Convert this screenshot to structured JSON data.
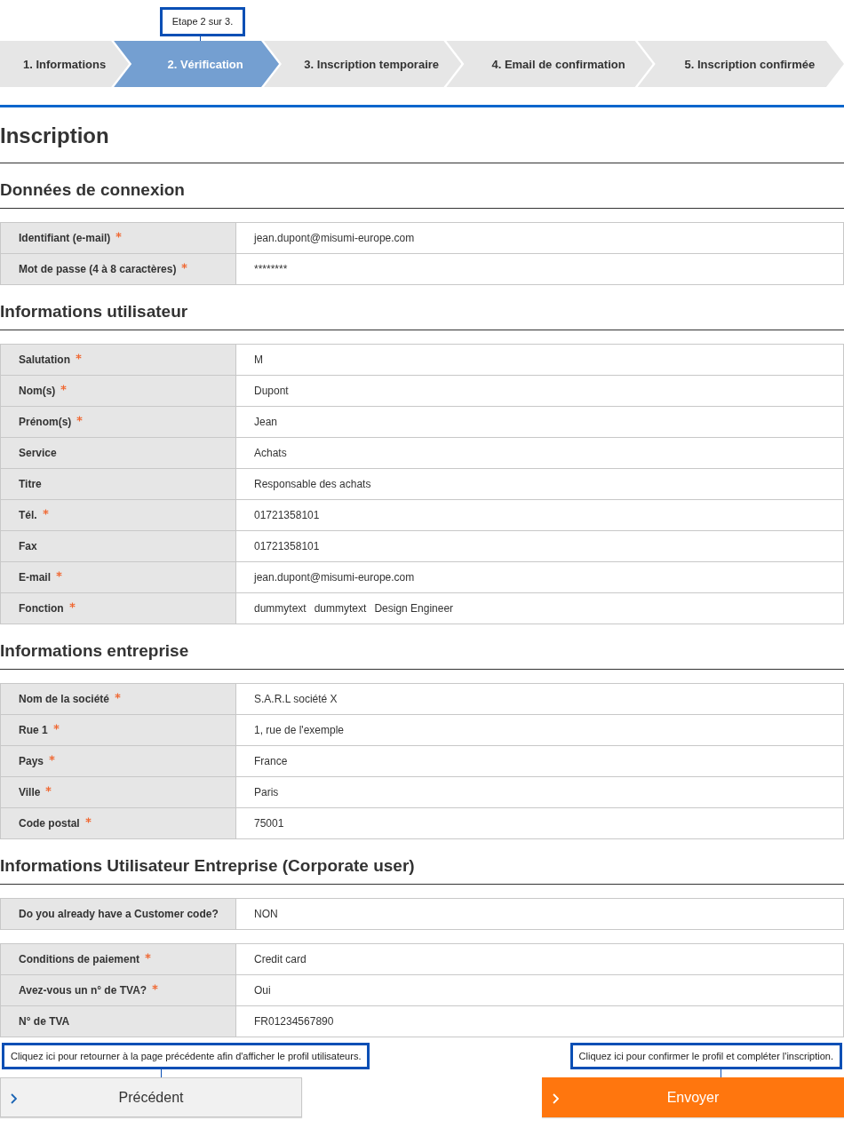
{
  "steps_tooltip": "Etape 2 sur 3.",
  "steps": [
    {
      "label": "1. Informations",
      "selected": false
    },
    {
      "label": "2. Vérification",
      "selected": true
    },
    {
      "label": "3. Inscription temporaire",
      "selected": false
    },
    {
      "label": "4. Email de confirmation",
      "selected": false
    },
    {
      "label": "5. Inscription confirmée",
      "selected": false
    }
  ],
  "title": "Inscription",
  "sections": [
    {
      "heading": "Données de connexion",
      "tables": [
        [
          {
            "label": "Identifiant (e-mail)",
            "required": true,
            "value": "jean.dupont@misumi-europe.com"
          },
          {
            "label": "Mot de passe (4 à 8 caractères)",
            "required": true,
            "value": "********"
          }
        ]
      ]
    },
    {
      "heading": "Informations utilisateur",
      "tables": [
        [
          {
            "label": "Salutation",
            "required": true,
            "value": "M"
          },
          {
            "label": "Nom(s)",
            "required": true,
            "value": "Dupont"
          },
          {
            "label": "Prénom(s)",
            "required": true,
            "value": "Jean"
          },
          {
            "label": "Service",
            "required": false,
            "value": "Achats"
          },
          {
            "label": "Titre",
            "required": false,
            "value": "Responsable des achats"
          },
          {
            "label": "Tél.",
            "required": true,
            "value": "01721358101"
          },
          {
            "label": "Fax",
            "required": false,
            "value": "01721358101"
          },
          {
            "label": "E-mail",
            "required": true,
            "value": "jean.dupont@misumi-europe.com"
          },
          {
            "label": "Fonction",
            "required": true,
            "values": [
              "dummytext",
              "dummytext",
              "Design Engineer"
            ]
          }
        ]
      ]
    },
    {
      "heading": "Informations entreprise",
      "tables": [
        [
          {
            "label": "Nom de la société",
            "required": true,
            "value": "S.A.R.L société X"
          },
          {
            "label": "Rue 1",
            "required": true,
            "value": "1, rue de l'exemple"
          },
          {
            "label": "Pays",
            "required": true,
            "value": "France"
          },
          {
            "label": "Ville",
            "required": true,
            "value": "Paris"
          },
          {
            "label": "Code postal",
            "required": true,
            "value": "75001"
          }
        ]
      ]
    },
    {
      "heading": "Informations Utilisateur Entreprise (Corporate user)",
      "tables": [
        [
          {
            "label": "Do you already have a Customer code?",
            "required": false,
            "value": "NON"
          }
        ],
        [
          {
            "label": "Conditions de paiement",
            "required": true,
            "value": "Credit card"
          },
          {
            "label": "Avez-vous un n° de TVA?",
            "required": true,
            "value": "Oui"
          },
          {
            "label": "N° de TVA",
            "required": false,
            "value": "FR01234567890"
          }
        ]
      ]
    }
  ],
  "back_tooltip": "Cliquez ici pour retourner à la page précédente afin d'afficher le profil utilisateurs.",
  "submit_tooltip": "Cliquez ici pour confirmer le profil et compléter l'inscription.",
  "back_button": "Précédent",
  "submit_button": "Envoyer"
}
